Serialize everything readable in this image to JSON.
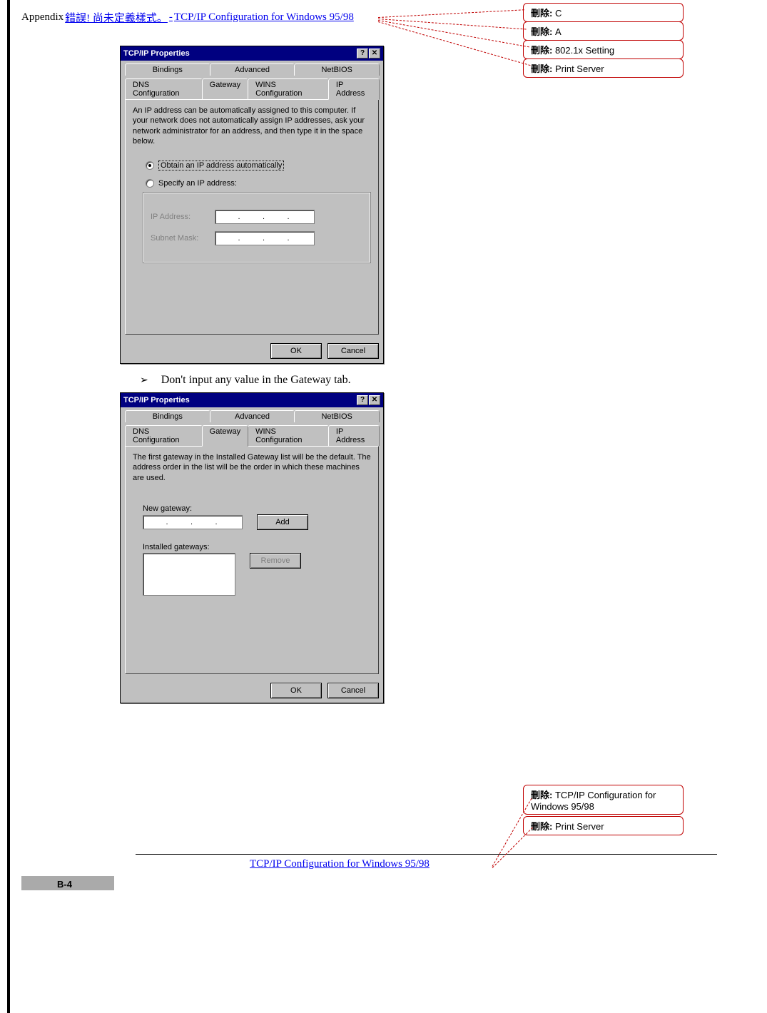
{
  "header": {
    "appendix": "Appendix ",
    "error_text": "錯誤! 尚未定義樣式。",
    "separator": " - ",
    "title": "TCP/IP Configuration for Windows 95/98"
  },
  "dialog1": {
    "title": "TCP/IP Properties",
    "help_btn": "?",
    "close_btn": "✕",
    "tabs_row1": [
      "Bindings",
      "Advanced",
      "NetBIOS"
    ],
    "tabs_row2": [
      "DNS Configuration",
      "Gateway",
      "WINS Configuration",
      "IP Address"
    ],
    "active_tab": "IP Address",
    "desc": "An IP address can be automatically assigned to this computer. If your network does not automatically assign IP addresses, ask your network administrator for an address, and then type it in the space below.",
    "radio1": "Obtain an IP address automatically",
    "radio2": "Specify an IP address:",
    "field1": "IP Address:",
    "field2": "Subnet Mask:",
    "ok": "OK",
    "cancel": "Cancel"
  },
  "bullet1": "Don't input any value in the Gateway tab.",
  "dialog2": {
    "title": "TCP/IP Properties",
    "help_btn": "?",
    "close_btn": "✕",
    "tabs_row1": [
      "Bindings",
      "Advanced",
      "NetBIOS"
    ],
    "tabs_row2": [
      "DNS Configuration",
      "Gateway",
      "WINS Configuration",
      "IP Address"
    ],
    "active_tab": "Gateway",
    "desc": "The first gateway in the Installed Gateway list will be the default. The address order in the list will be the order in which these machines are used.",
    "new_gw": "New gateway:",
    "add": "Add",
    "inst_gw": "Installed gateways:",
    "remove": "Remove",
    "ok": "OK",
    "cancel": "Cancel"
  },
  "footer": {
    "text": "TCP/IP Configuration for Windows 95/98",
    "page": "B-4"
  },
  "balloons": {
    "label": "刪除:",
    "b1": " C",
    "b2": " A",
    "b3": " 802.1x Setting",
    "b4": " Print Server",
    "b5": " TCP/IP Configuration for Windows 95/98",
    "b6": " Print Server"
  }
}
